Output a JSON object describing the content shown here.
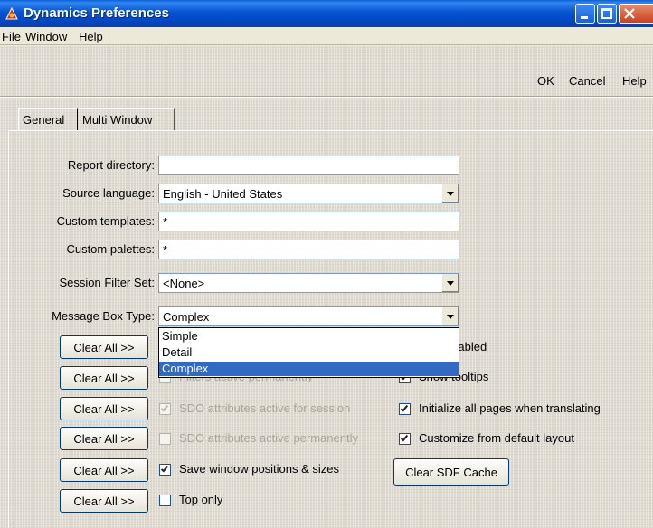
{
  "window": {
    "title": "Dynamics Preferences"
  },
  "menu": [
    "File",
    "Window",
    "Help"
  ],
  "actions": {
    "ok": "OK",
    "cancel": "Cancel",
    "help": "Help"
  },
  "tabs": [
    {
      "label": "General",
      "active": true
    },
    {
      "label": "Multi Window",
      "active": false
    }
  ],
  "form": {
    "report_directory": {
      "label": "Report directory:",
      "value": ""
    },
    "source_language": {
      "label": "Source language:",
      "value": "English - United States"
    },
    "custom_templates": {
      "label": "Custom templates:",
      "value": "*"
    },
    "custom_palettes": {
      "label": "Custom palettes:",
      "value": "*"
    },
    "session_filter_set": {
      "label": "Session Filter Set:",
      "value": "<None>"
    },
    "message_box_type": {
      "label": "Message Box Type:",
      "value": "Complex",
      "options": [
        "Simple",
        "Detail",
        "Complex"
      ],
      "highlighted": "Complex"
    }
  },
  "left_rows": [
    {
      "button": "Clear All >>",
      "checkbox_label": "",
      "checked": false,
      "disabled": false
    },
    {
      "button": "Clear All >>",
      "checkbox_label": "Filters active permanently",
      "checked": false,
      "disabled": true
    },
    {
      "button": "Clear All >>",
      "checkbox_label": "SDO attributes active for session",
      "checked": true,
      "disabled": true
    },
    {
      "button": "Clear All >>",
      "checkbox_label": "SDO attributes active permanently",
      "checked": false,
      "disabled": true
    },
    {
      "button": "Clear All >>",
      "checkbox_label": "Save window positions & sizes",
      "checked": true,
      "disabled": false
    },
    {
      "button": "Clear All >>",
      "checkbox_label": "Top only",
      "checked": false,
      "disabled": false
    }
  ],
  "right_options": [
    {
      "label": "alert enabled",
      "checked": true
    },
    {
      "label": "Show tooltips",
      "checked": true
    },
    {
      "label": "Initialize all pages when translating",
      "checked": true
    },
    {
      "label": "Customize from default layout",
      "checked": true
    }
  ],
  "clear_sdf_cache": "Clear SDF Cache",
  "colors": {
    "titlebar": "#0553d0",
    "selection": "#316ac5",
    "window_bg": "#ece9d8"
  }
}
